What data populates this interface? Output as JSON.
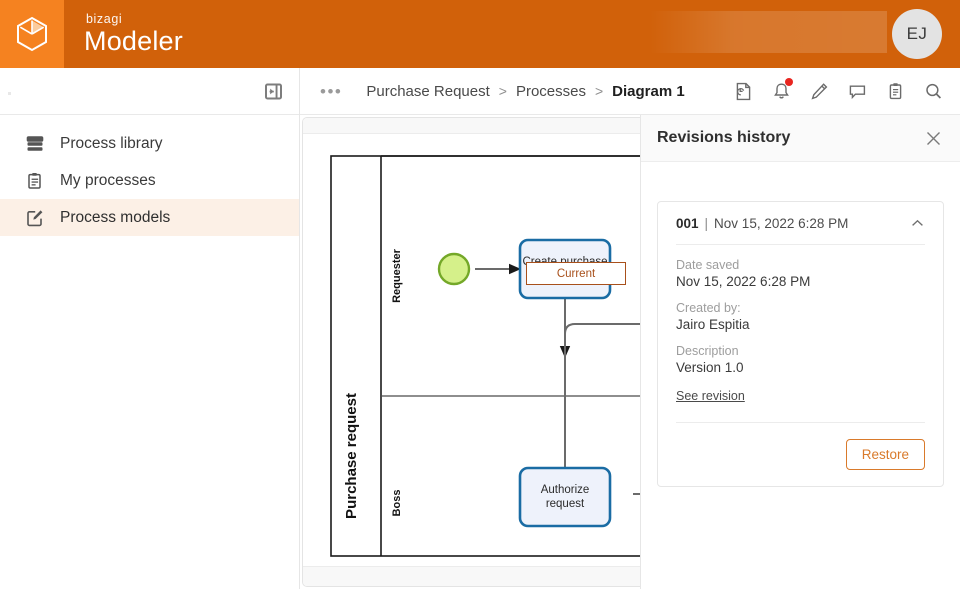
{
  "header": {
    "brand_small": "bizagi",
    "brand_big": "Modeler",
    "logo_icon": "cube-hexagon-logo",
    "avatar_initials": "EJ"
  },
  "sidebar": {
    "collapse_icon": "panel-collapse-left-icon",
    "items": [
      {
        "label": "Process library",
        "icon": "stacked-library-icon",
        "active": false
      },
      {
        "label": "My processes",
        "icon": "clipboard-icon",
        "active": false
      },
      {
        "label": "Process models",
        "icon": "edit-square-icon",
        "active": true
      }
    ]
  },
  "breadcrumb": {
    "more_label": "•••",
    "items": [
      "Purchase Request",
      "Processes",
      "Diagram 1"
    ],
    "separator": ">"
  },
  "toolbar": {
    "buttons": [
      {
        "name": "revisions-history-icon",
        "tooltip": "Revisions history",
        "badge": false
      },
      {
        "name": "bell-icon",
        "tooltip": "Notifications",
        "badge": true
      },
      {
        "name": "pencil-icon",
        "tooltip": "Edit",
        "badge": false
      },
      {
        "name": "comment-icon",
        "tooltip": "Comments",
        "badge": false
      },
      {
        "name": "clipboard-icon",
        "tooltip": "Tasks",
        "badge": false
      },
      {
        "name": "search-icon",
        "tooltip": "Search",
        "badge": false
      }
    ]
  },
  "diagram": {
    "current_badge": "Current",
    "pool_label": "Purchase request",
    "lanes": [
      "Requester",
      "Boss"
    ],
    "tasks": [
      {
        "label_line1": "Create purchase",
        "label_line2": "request"
      },
      {
        "label_line1": "Authorize",
        "label_line2": "request"
      }
    ],
    "colors": {
      "task_fill": "#EEF2FB",
      "task_border": "#1A6CA4",
      "start_event_fill": "#D5F08A",
      "start_event_border": "#74A828",
      "connector": "#6b6b6b",
      "badge_accent": "#A8501B"
    },
    "zoom_controls": [
      {
        "name": "zoom-in-icon"
      },
      {
        "name": "zoom-fit-icon"
      },
      {
        "name": "zoom-out-icon"
      }
    ]
  },
  "revisions": {
    "title": "Revisions history",
    "close_icon": "close-icon",
    "entries": [
      {
        "number": "001",
        "separator": "|",
        "header_date": "Nov 15, 2022 6:28 PM",
        "chevron_icon": "chevron-up-icon",
        "expanded": true,
        "fields": [
          {
            "label": "Date saved",
            "value": "Nov 15, 2022 6:28 PM"
          },
          {
            "label": "Created by:",
            "value": "Jairo Espitia"
          },
          {
            "label": "Description",
            "value": "Version 1.0"
          }
        ],
        "link_label": "See revision",
        "restore_label": "Restore"
      }
    ]
  },
  "theme": {
    "header_bg": "#D1610A",
    "logo_tile_bg": "#F58220",
    "accent_orange": "#D97A2B",
    "active_nav_bg": "#FCF0E6"
  }
}
